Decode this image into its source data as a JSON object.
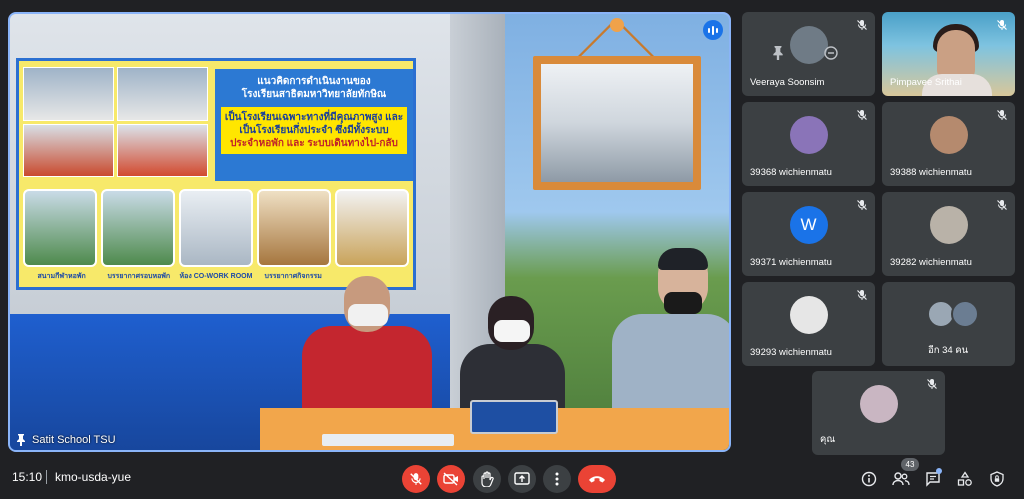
{
  "stage": {
    "presenter_label": "Satit School TSU",
    "slide": {
      "title_line1": "แนวคิดการดำเนินงานของ",
      "title_line2": "โรงเรียนสาธิตมหาวิทยาลัยทักษิณ",
      "band_line1": "เป็นโรงเรียนเฉพาะทางที่มีคุณภาพสูง และ",
      "band_line2": "เป็นโรงเรียนกึ่งประจำ ซึ่งมีทั้งระบบ",
      "band_line3": "ประจำหอพัก และ ระบบเดินทางไป-กลับ",
      "captions": [
        "สนามกีฬาหอพัก",
        "บรรยากาศรอบหอพัก",
        "ห้อง CO-WORK ROOM",
        "บรรยากาศกิจกรรม",
        ""
      ]
    }
  },
  "participants": [
    {
      "name": "Veeraya Soonsim",
      "type": "avatar-with-controls"
    },
    {
      "name": "Pimpavee Srithai",
      "type": "video"
    },
    {
      "name": "39368 wichienmatu",
      "type": "avatar"
    },
    {
      "name": "39388 wichienmatu",
      "type": "avatar"
    },
    {
      "name": "39371 wichienmatu",
      "type": "initial",
      "initial": "W",
      "color": "#1a73e8"
    },
    {
      "name": "39282 wichienmatu",
      "type": "avatar"
    },
    {
      "name": "39293 wichienmatu",
      "type": "avatar"
    },
    {
      "name": "อีก 34 คน",
      "type": "more"
    },
    {
      "name": "คุณ",
      "type": "avatar"
    }
  ],
  "bottom": {
    "time": "15:10",
    "meeting_code": "kmo-usda-yue",
    "people_count": "43"
  },
  "colors": {
    "background": "#202124",
    "tile": "#3c4043",
    "danger": "#ea4335",
    "accent": "#8ab4f8"
  }
}
